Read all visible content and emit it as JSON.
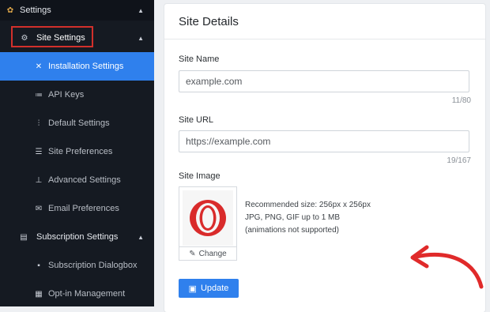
{
  "sidebar": {
    "header": {
      "label": "Settings",
      "icon": "gear-icon"
    },
    "section": {
      "label": "Site Settings",
      "icon": "gear-outline-icon"
    },
    "items": [
      {
        "label": "Installation Settings",
        "icon": "tools-icon",
        "active": true
      },
      {
        "label": "API Keys",
        "icon": "key-list-icon"
      },
      {
        "label": "Default Settings",
        "icon": "sliders-icon"
      },
      {
        "label": "Site Preferences",
        "icon": "sliders-horizontal-icon"
      },
      {
        "label": "Advanced Settings",
        "icon": "sitemap-icon"
      },
      {
        "label": "Email Preferences",
        "icon": "envelope-icon"
      }
    ],
    "subscription": {
      "label": "Subscription Settings",
      "icon": "document-icon"
    },
    "sub_items": [
      {
        "label": "Subscription Dialogbox",
        "icon": "comment-icon"
      },
      {
        "label": "Opt-in Management",
        "icon": "grid-icon"
      }
    ]
  },
  "main": {
    "title": "Site Details",
    "site_name": {
      "label": "Site Name",
      "value": "example.com",
      "counter": "11/80"
    },
    "site_url": {
      "label": "Site URL",
      "value": "https://example.com",
      "counter": "19/167"
    },
    "site_image": {
      "label": "Site Image",
      "change_label": "Change",
      "info": [
        "Recommended size: 256px x 256px",
        "JPG, PNG, GIF up to 1 MB",
        "(animations not supported)"
      ]
    },
    "update_label": "Update"
  },
  "colors": {
    "accent": "#2f80ed",
    "sidebar_bg": "#151a22",
    "highlight": "#d2302b",
    "annotation": "#e02a2a"
  }
}
